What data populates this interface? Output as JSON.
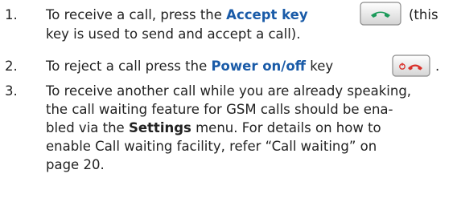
{
  "items": [
    {
      "number": "1.",
      "line1_pre": "To receive a call, press the ",
      "key_name": "Accept key",
      "line1_post": "(this",
      "line2": "key is used to send and accept a call).",
      "icon": "accept-call-key-icon"
    },
    {
      "number": "2.",
      "line1_pre": "To reject a call press the ",
      "key_name": "Power on/off",
      "line1_post": " key",
      "line1_end": ".",
      "icon": "power-end-call-key-icon"
    },
    {
      "number": "3.",
      "line1": "To receive another call while you are already speaking,",
      "line2": "the call waiting feature for GSM calls should be ena-",
      "line3_pre": "bled via the ",
      "line3_bold": "Settings",
      "line3_post": " menu. For details on how to",
      "line4": "enable Call waiting facility, refer “Call waiting” on",
      "line5": "page 20."
    }
  ],
  "colors": {
    "keyword": "#1a5ba8",
    "accept_green": "#1c9a5a",
    "end_red": "#d9302a"
  }
}
